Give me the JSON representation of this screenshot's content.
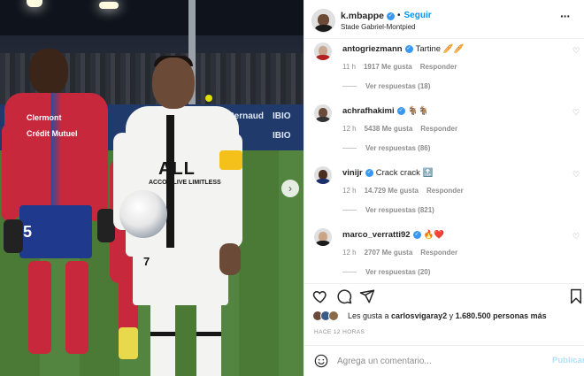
{
  "post": {
    "username": "k.mbappe",
    "follow_separator": "•",
    "follow_label": "Seguir",
    "location": "Stade Gabriel-Montpied",
    "more_label": "···",
    "next_label": "›"
  },
  "photo": {
    "hoarding_left": "Pernaud",
    "hoarding_mid": "IBIO",
    "hoarding_right": "IBIO",
    "p1_crest": "Clermont",
    "p1_sponsor": "Crédit Mutuel",
    "p1_number": "5",
    "jersey_text": "ALL",
    "jersey_sub": "ACCOR LIVE LIMITLESS",
    "shorts_number": "7"
  },
  "comments": [
    {
      "user": "antogriezmann",
      "verified": true,
      "text": "Tartine 🥖🥖",
      "time": "11 h",
      "likes": "1917 Me gusta",
      "reply": "Responder",
      "replies": "Ver respuestas (18)",
      "avatar_color": "#c7a58f",
      "torso_color": "#b22222"
    },
    {
      "user": "achrafhakimi",
      "verified": true,
      "text": "🐐🐐",
      "time": "12 h",
      "likes": "5438 Me gusta",
      "reply": "Responder",
      "replies": "Ver respuestas (86)",
      "avatar_color": "#6a4a3a",
      "torso_color": "#333333"
    },
    {
      "user": "vinijr",
      "verified": true,
      "text": "Crack crack 🔝",
      "time": "12 h",
      "likes": "14.729 Me gusta",
      "reply": "Responder",
      "replies": "Ver respuestas (821)",
      "avatar_color": "#4a2f22",
      "torso_color": "#1c2f6b"
    },
    {
      "user": "marco_verratti92",
      "verified": true,
      "text": "🔥❤️",
      "time": "12 h",
      "likes": "2707 Me gusta",
      "reply": "Responder",
      "replies": "Ver respuestas (20)",
      "avatar_color": "#caa588",
      "torso_color": "#1b1b1b"
    }
  ],
  "likes": {
    "prefix": "Les gusta a ",
    "user": "carlosvigaray2",
    "middle": " y ",
    "count": "1.680.500 personas más"
  },
  "timestamp": "HACE 12 HORAS",
  "comment_box": {
    "placeholder": "Agrega un comentario...",
    "publish_label": "Publicar"
  },
  "icons": {
    "like": "heart-icon",
    "comment": "comment-icon",
    "share": "send-icon",
    "save": "bookmark-icon",
    "emoji": "emoji-icon"
  },
  "colors": {
    "accent": "#0095f6",
    "verified": "#3897f0",
    "muted": "#8e8e8e",
    "publish_disabled": "#b2dffc"
  }
}
